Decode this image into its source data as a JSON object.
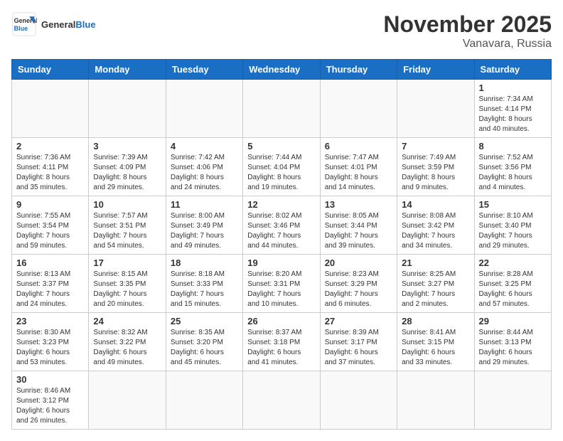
{
  "logo": {
    "text_general": "General",
    "text_blue": "Blue"
  },
  "title": "November 2025",
  "subtitle": "Vanavara, Russia",
  "weekdays": [
    "Sunday",
    "Monday",
    "Tuesday",
    "Wednesday",
    "Thursday",
    "Friday",
    "Saturday"
  ],
  "days": [
    {
      "date": "",
      "info": ""
    },
    {
      "date": "",
      "info": ""
    },
    {
      "date": "",
      "info": ""
    },
    {
      "date": "",
      "info": ""
    },
    {
      "date": "",
      "info": ""
    },
    {
      "date": "",
      "info": ""
    },
    {
      "date": "1",
      "info": "Sunrise: 7:34 AM\nSunset: 4:14 PM\nDaylight: 8 hours\nand 40 minutes."
    },
    {
      "date": "2",
      "info": "Sunrise: 7:36 AM\nSunset: 4:11 PM\nDaylight: 8 hours\nand 35 minutes."
    },
    {
      "date": "3",
      "info": "Sunrise: 7:39 AM\nSunset: 4:09 PM\nDaylight: 8 hours\nand 29 minutes."
    },
    {
      "date": "4",
      "info": "Sunrise: 7:42 AM\nSunset: 4:06 PM\nDaylight: 8 hours\nand 24 minutes."
    },
    {
      "date": "5",
      "info": "Sunrise: 7:44 AM\nSunset: 4:04 PM\nDaylight: 8 hours\nand 19 minutes."
    },
    {
      "date": "6",
      "info": "Sunrise: 7:47 AM\nSunset: 4:01 PM\nDaylight: 8 hours\nand 14 minutes."
    },
    {
      "date": "7",
      "info": "Sunrise: 7:49 AM\nSunset: 3:59 PM\nDaylight: 8 hours\nand 9 minutes."
    },
    {
      "date": "8",
      "info": "Sunrise: 7:52 AM\nSunset: 3:56 PM\nDaylight: 8 hours\nand 4 minutes."
    },
    {
      "date": "9",
      "info": "Sunrise: 7:55 AM\nSunset: 3:54 PM\nDaylight: 7 hours\nand 59 minutes."
    },
    {
      "date": "10",
      "info": "Sunrise: 7:57 AM\nSunset: 3:51 PM\nDaylight: 7 hours\nand 54 minutes."
    },
    {
      "date": "11",
      "info": "Sunrise: 8:00 AM\nSunset: 3:49 PM\nDaylight: 7 hours\nand 49 minutes."
    },
    {
      "date": "12",
      "info": "Sunrise: 8:02 AM\nSunset: 3:46 PM\nDaylight: 7 hours\nand 44 minutes."
    },
    {
      "date": "13",
      "info": "Sunrise: 8:05 AM\nSunset: 3:44 PM\nDaylight: 7 hours\nand 39 minutes."
    },
    {
      "date": "14",
      "info": "Sunrise: 8:08 AM\nSunset: 3:42 PM\nDaylight: 7 hours\nand 34 minutes."
    },
    {
      "date": "15",
      "info": "Sunrise: 8:10 AM\nSunset: 3:40 PM\nDaylight: 7 hours\nand 29 minutes."
    },
    {
      "date": "16",
      "info": "Sunrise: 8:13 AM\nSunset: 3:37 PM\nDaylight: 7 hours\nand 24 minutes."
    },
    {
      "date": "17",
      "info": "Sunrise: 8:15 AM\nSunset: 3:35 PM\nDaylight: 7 hours\nand 20 minutes."
    },
    {
      "date": "18",
      "info": "Sunrise: 8:18 AM\nSunset: 3:33 PM\nDaylight: 7 hours\nand 15 minutes."
    },
    {
      "date": "19",
      "info": "Sunrise: 8:20 AM\nSunset: 3:31 PM\nDaylight: 7 hours\nand 10 minutes."
    },
    {
      "date": "20",
      "info": "Sunrise: 8:23 AM\nSunset: 3:29 PM\nDaylight: 7 hours\nand 6 minutes."
    },
    {
      "date": "21",
      "info": "Sunrise: 8:25 AM\nSunset: 3:27 PM\nDaylight: 7 hours\nand 2 minutes."
    },
    {
      "date": "22",
      "info": "Sunrise: 8:28 AM\nSunset: 3:25 PM\nDaylight: 6 hours\nand 57 minutes."
    },
    {
      "date": "23",
      "info": "Sunrise: 8:30 AM\nSunset: 3:23 PM\nDaylight: 6 hours\nand 53 minutes."
    },
    {
      "date": "24",
      "info": "Sunrise: 8:32 AM\nSunset: 3:22 PM\nDaylight: 6 hours\nand 49 minutes."
    },
    {
      "date": "25",
      "info": "Sunrise: 8:35 AM\nSunset: 3:20 PM\nDaylight: 6 hours\nand 45 minutes."
    },
    {
      "date": "26",
      "info": "Sunrise: 8:37 AM\nSunset: 3:18 PM\nDaylight: 6 hours\nand 41 minutes."
    },
    {
      "date": "27",
      "info": "Sunrise: 8:39 AM\nSunset: 3:17 PM\nDaylight: 6 hours\nand 37 minutes."
    },
    {
      "date": "28",
      "info": "Sunrise: 8:41 AM\nSunset: 3:15 PM\nDaylight: 6 hours\nand 33 minutes."
    },
    {
      "date": "29",
      "info": "Sunrise: 8:44 AM\nSunset: 3:13 PM\nDaylight: 6 hours\nand 29 minutes."
    },
    {
      "date": "30",
      "info": "Sunrise: 8:46 AM\nSunset: 3:12 PM\nDaylight: 6 hours\nand 26 minutes."
    },
    {
      "date": "",
      "info": ""
    },
    {
      "date": "",
      "info": ""
    },
    {
      "date": "",
      "info": ""
    },
    {
      "date": "",
      "info": ""
    },
    {
      "date": "",
      "info": ""
    },
    {
      "date": "",
      "info": ""
    }
  ]
}
